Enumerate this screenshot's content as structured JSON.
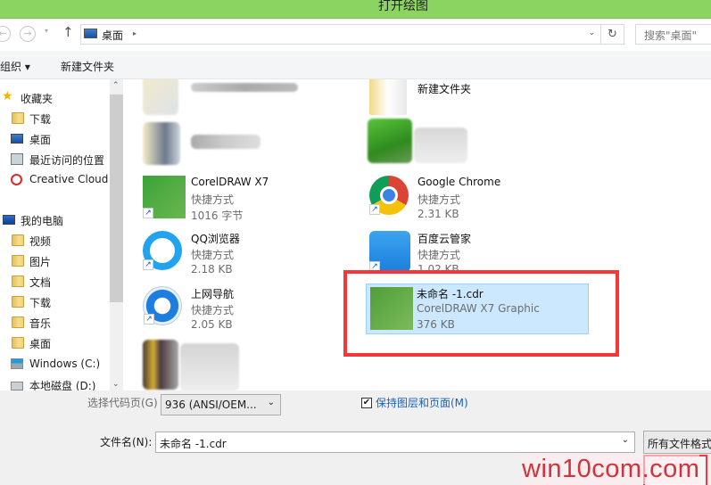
{
  "window": {
    "title": "打开绘图"
  },
  "nav": {
    "back_icon": "←",
    "forward_icon": "→",
    "recent_icon": "▾",
    "up_icon": "↑",
    "address": "桌面",
    "address_arrow": "▸",
    "address_dropdown": "⌄",
    "refresh_icon": "↻",
    "search_placeholder": "搜索\"桌面\""
  },
  "toolbar": {
    "organize": "组织 ▾",
    "new_folder": "新建文件夹"
  },
  "sidebar": {
    "favorites": {
      "label": "收藏夹",
      "items": [
        {
          "label": "下载"
        },
        {
          "label": "桌面"
        },
        {
          "label": "最近访问的位置"
        },
        {
          "label": "Creative Cloud"
        }
      ]
    },
    "computer": {
      "label": "我的电脑",
      "items": [
        {
          "label": "视频"
        },
        {
          "label": "图片"
        },
        {
          "label": "文档"
        },
        {
          "label": "下载"
        },
        {
          "label": "音乐"
        },
        {
          "label": "桌面"
        },
        {
          "label": "Windows (C:)"
        },
        {
          "label": "本地磁盘 (D:)"
        }
      ]
    },
    "scroll_up": "⌃",
    "scroll_down": "⌄"
  },
  "files": [
    {
      "name": "",
      "type": "",
      "size": "",
      "blurred": true
    },
    {
      "name": "新建文件夹",
      "type": "",
      "size": ""
    },
    {
      "name": "",
      "type": "",
      "size": "",
      "blurred": true
    },
    {
      "name": "",
      "type": "",
      "size": "",
      "blurred": true
    },
    {
      "name": "CorelDRAW X7",
      "type": "快捷方式",
      "size": "1016 字节"
    },
    {
      "name": "Google Chrome",
      "type": "快捷方式",
      "size": "2.31 KB"
    },
    {
      "name": "QQ浏览器",
      "type": "快捷方式",
      "size": "2.18 KB"
    },
    {
      "name": "百度云管家",
      "type": "快捷方式",
      "size": "1.02 KB"
    },
    {
      "name": "上网导航",
      "type": "快捷方式",
      "size": "2.05 KB"
    },
    {
      "name": "未命名 -1.cdr",
      "type": "CorelDRAW X7 Graphic",
      "size": "376 KB",
      "selected": true
    },
    {
      "name": "",
      "type": "",
      "size": "",
      "blurred": true
    }
  ],
  "shortcut_arrow": "↗",
  "bottom": {
    "codepage_label": "选择代码页(G)",
    "codepage_value": "936   (ANSI/OEM...",
    "keep_layers_label": "保持图层和页面(M)",
    "keep_layers_checked": "✔",
    "filename_label": "文件名(N):",
    "filename_value": "未命名 -1.cdr",
    "filetype_value": "所有文件格式",
    "dropdown_icon": "⌄"
  },
  "watermark": "win10com.com",
  "colors": {
    "title_bar": "#8bd462",
    "selection": "#cce8ff",
    "highlight_box": "#f4373b",
    "link": "#1d62b5"
  }
}
